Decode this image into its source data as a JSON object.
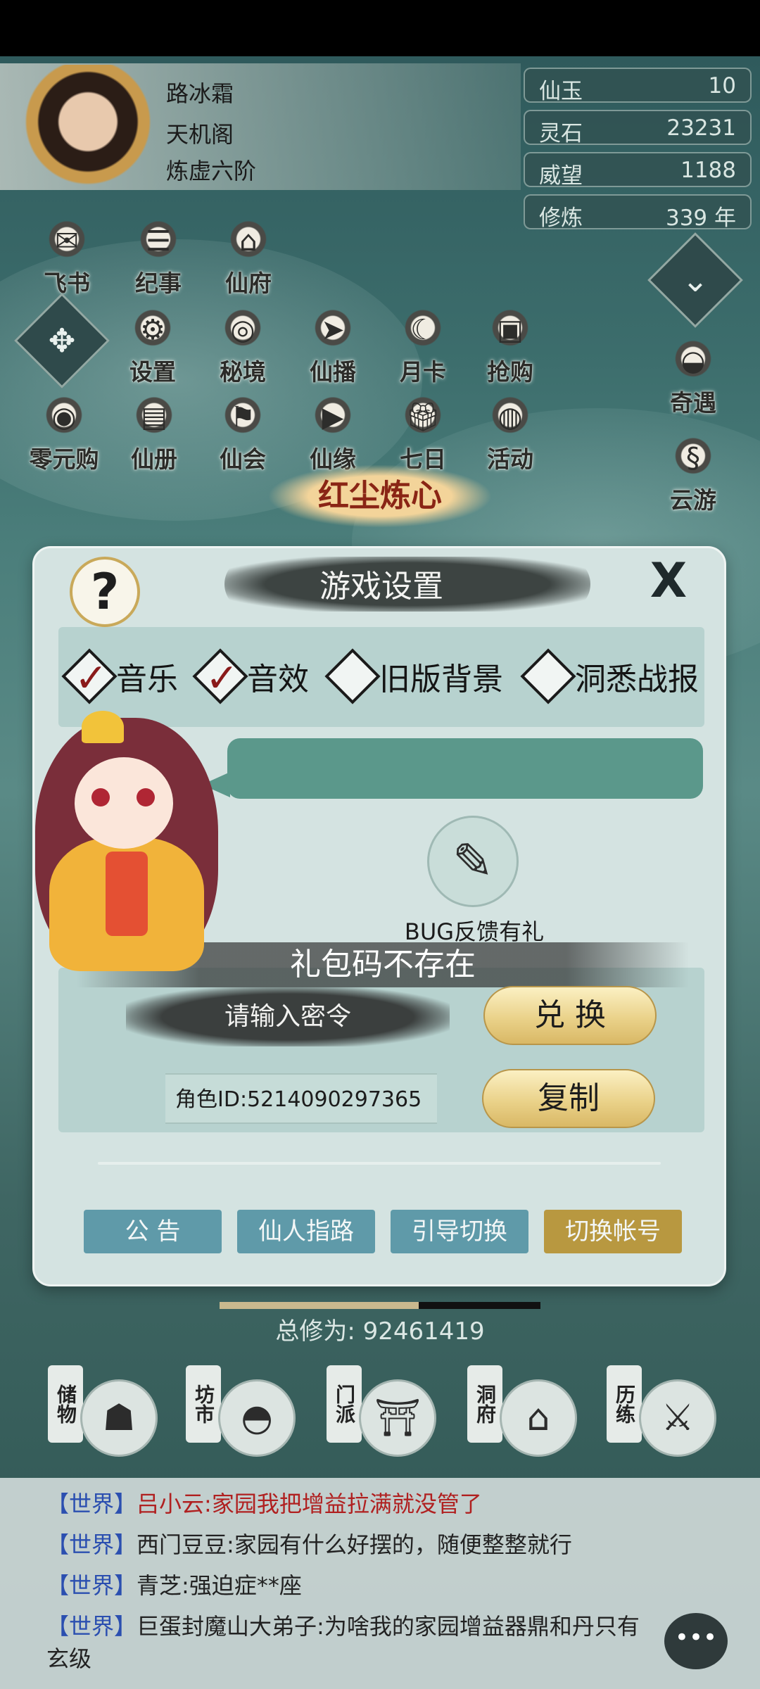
{
  "player": {
    "name": "路冰霜",
    "sect": "天机阁",
    "rank": "炼虚六阶"
  },
  "resources": [
    {
      "label": "仙玉",
      "value": "10"
    },
    {
      "label": "灵石",
      "value": "23231"
    },
    {
      "label": "威望",
      "value": "1188"
    },
    {
      "label": "修炼",
      "value": "339 年"
    }
  ],
  "top_icons": [
    {
      "label": "飞书",
      "icon": "letter-icon"
    },
    {
      "label": "纪事",
      "icon": "scroll-icon"
    },
    {
      "label": "仙府",
      "icon": "mansion-icon"
    }
  ],
  "mid_icons": [
    {
      "label": "设置",
      "icon": "gear-icon"
    },
    {
      "label": "秘境",
      "icon": "vortex-icon"
    },
    {
      "label": "仙播",
      "icon": "signpost-icon"
    },
    {
      "label": "月卡",
      "icon": "card-icon"
    },
    {
      "label": "抢购",
      "icon": "chest-icon"
    }
  ],
  "row3_icons": [
    {
      "label": "零元购",
      "icon": "coins-icon"
    },
    {
      "label": "仙册",
      "icon": "book-icon"
    },
    {
      "label": "仙会",
      "icon": "banner-icon"
    },
    {
      "label": "仙缘",
      "icon": "play-icon"
    },
    {
      "label": "七日",
      "icon": "gift-icon"
    },
    {
      "label": "活动",
      "icon": "lantern-icon"
    }
  ],
  "side_icons": [
    {
      "label": "奇遇",
      "icon": "bowl-icon"
    },
    {
      "label": "云游",
      "icon": "dragon-icon"
    }
  ],
  "banner_text": "红尘炼心",
  "dialog": {
    "title": "游戏设置",
    "help_symbol": "?",
    "close_symbol": "X",
    "options": [
      {
        "label": "音乐",
        "checked": true
      },
      {
        "label": "音效",
        "checked": true
      },
      {
        "label": "旧版背景",
        "checked": false
      },
      {
        "label": "洞悉战报",
        "checked": false
      }
    ],
    "bug_label": "BUG反馈有礼",
    "toast": "礼包码不存在",
    "code_placeholder": "请输入密令",
    "redeem_label": "兑 换",
    "role_id": "角色ID:5214090297365",
    "copy_label": "复制",
    "bottom_buttons": [
      "公 告",
      "仙人指路",
      "引导切换",
      "切换帐号"
    ]
  },
  "cultivation": {
    "total_label": "总修为:",
    "total_value": "92461419"
  },
  "nav": [
    {
      "label": "储物",
      "icon": "bag-icon"
    },
    {
      "label": "坊市",
      "icon": "ingot-icon"
    },
    {
      "label": "门派",
      "icon": "gate-icon"
    },
    {
      "label": "洞府",
      "icon": "pavilion-icon"
    },
    {
      "label": "历练",
      "icon": "sword-icon"
    }
  ],
  "chat": [
    {
      "channel": "【世界】",
      "name": "吕小云:",
      "text": "家园我把增益拉满就没管了"
    },
    {
      "channel": "【世界】",
      "name": "西门豆豆:",
      "text": "家园有什么好摆的，随便整整就行"
    },
    {
      "channel": "【世界】",
      "name": "青芝:",
      "text": "强迫症**座"
    },
    {
      "channel": "【世界】",
      "name": "巨蛋封魔山大弟子:",
      "text": "为啥我的家园增益器鼎和丹只有玄级"
    }
  ],
  "chat_button": "•••",
  "colors": {
    "accent_gold": "#d9b865",
    "teal": "#5b988b",
    "chat_channel": "#2b4fb0"
  }
}
